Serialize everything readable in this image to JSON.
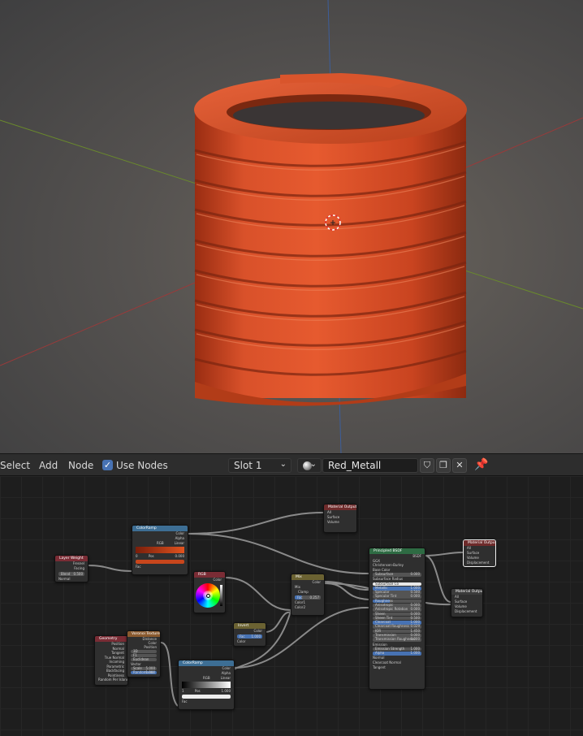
{
  "header": {
    "menu": [
      "Select",
      "Add",
      "Node"
    ],
    "use_nodes_label": "Use Nodes",
    "use_nodes_checked": true,
    "slot": "Slot 1",
    "material_name": "Red_Metall"
  },
  "nodes": {
    "output_top": {
      "title": "Material Output",
      "rows": [
        "All",
        "Surface",
        "Volume",
        "Displacement"
      ]
    },
    "output_right": {
      "title": "Material Output",
      "rows": [
        "All",
        "Surface",
        "Volume",
        "Displacement"
      ]
    },
    "output_mid": {
      "title": "Material Output",
      "rows": [
        "All",
        "Surface",
        "Volume",
        "Displacement"
      ]
    },
    "layer_weight": {
      "title": "Layer Weight",
      "rows": [
        "Fresnel",
        "Facing",
        "Blend",
        "Normal"
      ],
      "blend": "0.500"
    },
    "colorramp_top": {
      "title": "ColorRamp",
      "rows": [
        "Color",
        "Alpha",
        "Fac"
      ],
      "mode": "RGB",
      "interp": "Linear",
      "stop": "0",
      "pos_label": "Pos",
      "pos": "0.000"
    },
    "colorramp_bottom": {
      "title": "ColorRamp",
      "rows": [
        "Color",
        "Alpha",
        "Fac"
      ],
      "mode": "RGB",
      "interp": "Linear",
      "stop": "1",
      "pos_label": "Pos",
      "pos": "1.000"
    },
    "rgb": {
      "title": "RGB",
      "rows": [
        "Color"
      ]
    },
    "mix": {
      "title": "Mix",
      "rows": [
        "Color",
        "Mix",
        "Clamp",
        "Fac",
        "Color1",
        "Color2"
      ],
      "fac": "0.257"
    },
    "invert": {
      "title": "Invert",
      "rows": [
        "Color",
        "Fac",
        "Color"
      ],
      "fac": "1.000"
    },
    "geometry": {
      "title": "Geometry",
      "rows": [
        "Position",
        "Normal",
        "Tangent",
        "True Normal",
        "Incoming",
        "Parametric",
        "Backfacing",
        "Pointiness",
        "Random Per Island"
      ]
    },
    "voronoi": {
      "title": "Voronoi Texture",
      "rows": [
        "Distance",
        "Color",
        "Position",
        "3D",
        "F1",
        "Euclidean",
        "Vector",
        "Scale",
        "Randomness"
      ],
      "scale": "5.000",
      "random": "1.000"
    },
    "bsdf": {
      "title": "Principled BSDF",
      "rows": [
        "BSDF",
        "GGX",
        "Christensen-Burley",
        "Base Color",
        "Subsurface",
        "Subsurface Radius",
        "Subsurface Co",
        "Metallic",
        "Specular",
        "Specular Tint",
        "Roughness",
        "Anisotropic",
        "Anisotropic Rotation",
        "Sheen",
        "Sheen Tint",
        "Clearcoat",
        "Clearcoat Roughness",
        "IOR",
        "Transmission",
        "Transmission Roughness",
        "Emission",
        "Emission Strength",
        "Alpha",
        "Normal",
        "Clearcoat Normal",
        "Tangent"
      ],
      "values": {
        "Subsurface": "0.000",
        "Metallic": "1.000",
        "Specular": "0.500",
        "Specular Tint": "0.000",
        "Anisotropic": "0.000",
        "Anisotropic Rotation": "0.000",
        "Sheen": "0.000",
        "Sheen Tint": "0.500",
        "Clearcoat": "1.000",
        "Clearcoat Roughness": "0.029",
        "IOR": "1.450",
        "Transmission": "0.000",
        "Transmission Roughness": "0.000",
        "Emission Strength": "1.000",
        "Alpha": "1.000"
      }
    }
  },
  "colors": {
    "accent": "#4772b3",
    "spring": "#d4471f"
  }
}
